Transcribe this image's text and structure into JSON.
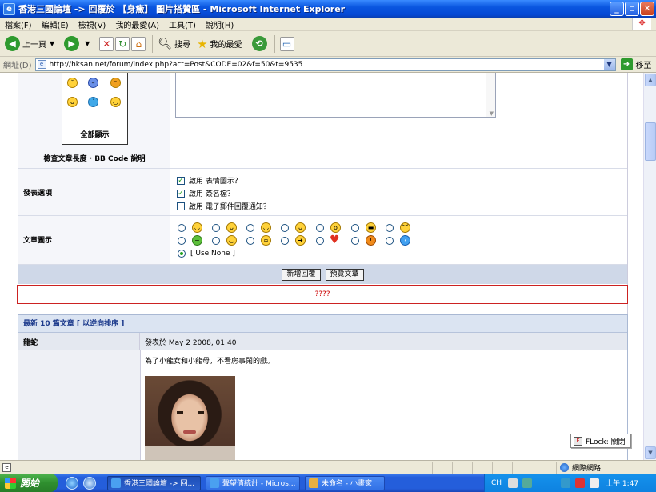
{
  "window": {
    "title": "香港三國論壇 -> 回覆於 【身癥】 圖片搭贊區 - Microsoft Internet Explorer",
    "icon": "ie-page-icon"
  },
  "menu": [
    "檔案(F)",
    "編輯(E)",
    "檢視(V)",
    "我的最愛(A)",
    "工具(T)",
    "說明(H)"
  ],
  "toolbar": {
    "back_label": "上一頁",
    "search_label": "搜尋",
    "favorites_label": "我的最愛"
  },
  "address": {
    "label": "網址(D)",
    "url": "http://hksan.net/forum/index.php?act=Post&CODE=02&f=50&t=9535",
    "go_label": "移至"
  },
  "emoticons": {
    "show_all": "全部顯示",
    "check_length": "檢查文章長度",
    "bbcode_help": "BB Code 說明"
  },
  "post_options": {
    "label": "發表選項",
    "items": [
      {
        "label": "啟用 表情圖示？",
        "checked": true
      },
      {
        "label": "啟用 簽名檔？",
        "checked": true
      },
      {
        "label": "啟用 電子郵件回覆通知？",
        "checked": false
      }
    ]
  },
  "post_icon": {
    "label": "文章圖示",
    "use_none": "[ Use None ]"
  },
  "buttons": {
    "submit": "新增回覆",
    "preview": "預覽文章"
  },
  "error_text": "????",
  "latest": {
    "header": "最新 10 篇文章 [ 以逆向排序 ]",
    "author": "龍蛇",
    "posted": "發表於 May 2 2008, 01:40",
    "message": "為了小龍女和小龍母，不看房事鬧的戲。"
  },
  "flock": {
    "label": "FLock: 關閉"
  },
  "status": {
    "zone": "網際網路"
  },
  "taskbar": {
    "start": "開始",
    "tasks": [
      {
        "label": "香港三國論壇 -> 回...",
        "active": true
      },
      {
        "label": "聲望值統計 - Micros...",
        "active": false
      },
      {
        "label": "未命名 - 小畫家",
        "active": false
      }
    ],
    "lang": "CH",
    "clock": "上午 1:47"
  },
  "colors": {
    "titlebar": "#0548d4",
    "accent_header": "#1c3a8c",
    "error_border": "#cc2222"
  }
}
